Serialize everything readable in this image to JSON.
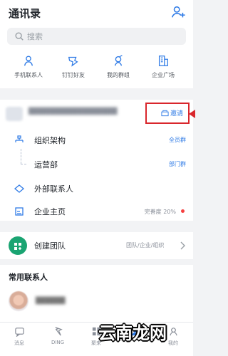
{
  "header": {
    "title": "通讯录",
    "add_icon": "add-contact-icon"
  },
  "search": {
    "placeholder": "搜索",
    "icon": "search-icon"
  },
  "quick_actions": [
    {
      "label": "手机联系人",
      "icon": "phone-contacts-icon"
    },
    {
      "label": "钉钉好友",
      "icon": "friend-icon"
    },
    {
      "label": "我的群组",
      "icon": "group-icon"
    },
    {
      "label": "企业广场",
      "icon": "building-icon"
    }
  ],
  "org": {
    "invite_label": "邀请",
    "rows": [
      {
        "label": "组织架构",
        "tag": "全员群"
      },
      {
        "label": "运营部",
        "tag": "部门群"
      },
      {
        "label": "外部联系人"
      },
      {
        "label": "企业主页",
        "completion": "完善度 20%"
      }
    ]
  },
  "team": {
    "label": "创建团队",
    "subtitle": "团队/企业/组织"
  },
  "frequent": {
    "title": "常用联系人"
  },
  "tabs": [
    {
      "label": "消息",
      "icon": "message-icon"
    },
    {
      "label": "DING",
      "icon": "ding-icon"
    },
    {
      "label": "聚来",
      "icon": "work-icon"
    },
    {
      "label": "",
      "icon": "contacts-icon"
    },
    {
      "label": "我的",
      "icon": "profile-icon"
    }
  ],
  "watermark": "云南龙网",
  "colors": {
    "accent": "#2f7be6",
    "team_green": "#1aa472",
    "highlight_red": "#d9262c",
    "text_dark": "#1f2329"
  }
}
